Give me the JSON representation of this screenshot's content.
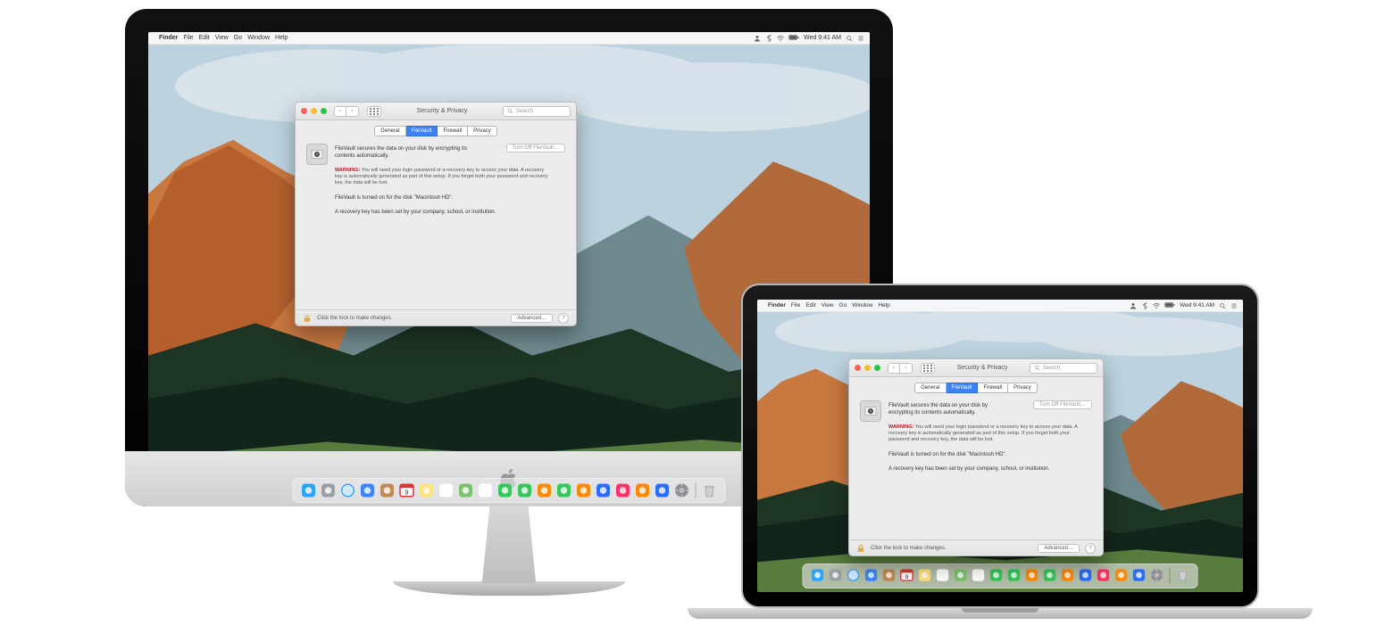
{
  "menubar": {
    "app": "Finder",
    "items": [
      "File",
      "Edit",
      "View",
      "Go",
      "Window",
      "Help"
    ],
    "clock": "Wed 9:41 AM"
  },
  "window": {
    "title": "Security & Privacy",
    "search_placeholder": "Search",
    "tabs": {
      "general": "General",
      "filevault": "FileVault",
      "firewall": "Firewall",
      "privacy": "Privacy"
    },
    "desc1": "FileVault secures the data on your disk by encrypting its contents automatically.",
    "turn_off": "Turn Off FileVault…",
    "warn_label": "WARNING:",
    "warn_text": " You will need your login password or a recovery key to access your data. A recovery key is automatically generated as part of this setup. If you forget both your password and recovery key, the data will be lost.",
    "desc2": "FileVault is turned on for the disk \"Macintosh HD\".",
    "desc3": "A recovery key has been set by your company, school, or institution.",
    "footer_lock": "Click the lock to make changes.",
    "advanced": "Advanced…",
    "help": "?"
  },
  "dock": {
    "items": [
      {
        "name": "finder",
        "color": "#2aa4ff"
      },
      {
        "name": "launchpad",
        "color": "#9aa0a6"
      },
      {
        "name": "safari",
        "color": "#2aa4ff"
      },
      {
        "name": "mail",
        "color": "#3a86ff"
      },
      {
        "name": "contacts",
        "color": "#c28a54"
      },
      {
        "name": "calendar",
        "color": "#ffffff"
      },
      {
        "name": "notes",
        "color": "#ffe27a"
      },
      {
        "name": "reminders",
        "color": "#ffffff"
      },
      {
        "name": "maps",
        "color": "#79c36a"
      },
      {
        "name": "photos",
        "color": "#ffffff"
      },
      {
        "name": "messages",
        "color": "#34c759"
      },
      {
        "name": "facetime",
        "color": "#34c759"
      },
      {
        "name": "photobooth",
        "color": "#ff8a00"
      },
      {
        "name": "numbers",
        "color": "#34c759"
      },
      {
        "name": "pages",
        "color": "#ff8a00"
      },
      {
        "name": "keynote",
        "color": "#2a6cff"
      },
      {
        "name": "itunes",
        "color": "#ff3366"
      },
      {
        "name": "ibooks",
        "color": "#ff8a00"
      },
      {
        "name": "appstore",
        "color": "#2a6cff"
      },
      {
        "name": "preferences",
        "color": "#8e8e93"
      }
    ],
    "trash": {
      "name": "trash",
      "color": "#d0d0d0"
    }
  },
  "calendar_day": "9"
}
